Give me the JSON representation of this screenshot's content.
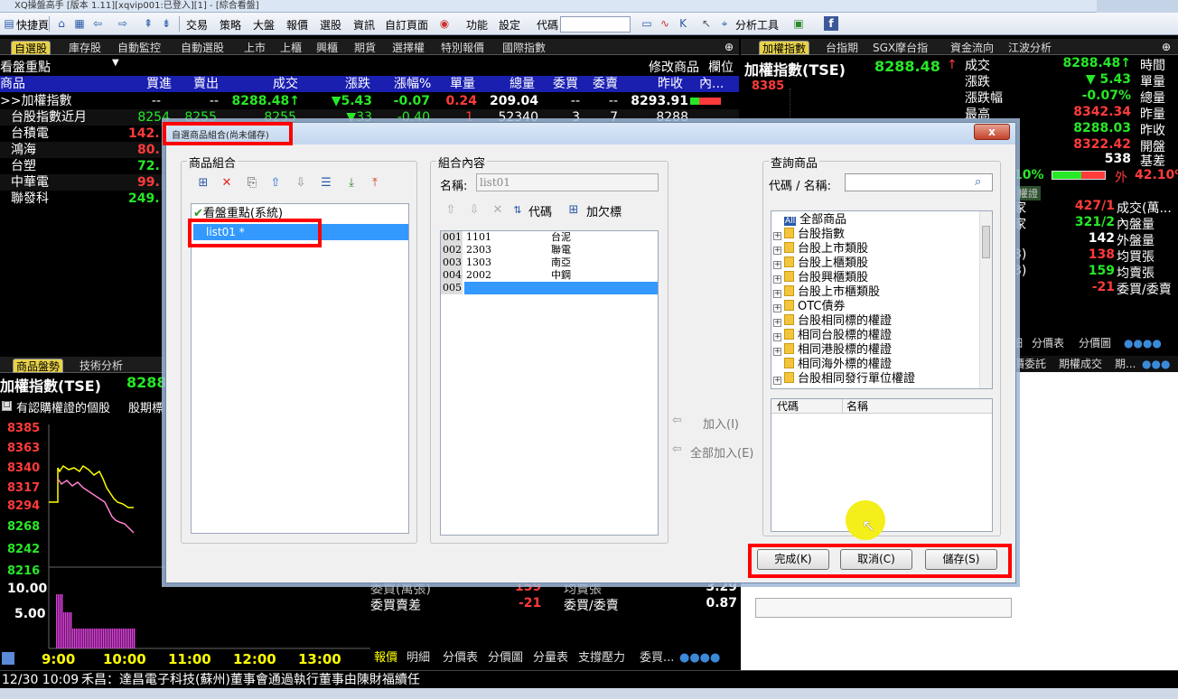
{
  "window": {
    "title": "XQ操盤高手 [版本 1.11][xqvip001:已登入][1] - [綜合看盤]"
  },
  "toolbar": {
    "quick_table": "快捷頁",
    "menus": [
      "交易",
      "策略",
      "大盤",
      "報價",
      "選股",
      "資訊",
      "自訂頁面",
      "功能",
      "設定"
    ],
    "code_label": "代碼",
    "analysis_tools": "分析工具"
  },
  "left_tabs": [
    "自選股",
    "庫存股",
    "自動監控",
    "自動選股",
    "上市",
    "上櫃",
    "興櫃",
    "期貨",
    "選擇權",
    "特別報價",
    "國際指數"
  ],
  "group_selector": "看盤重點",
  "edit_products": "修改商品",
  "edit_columns": "欄位",
  "quote_headers": [
    "商品",
    "買進",
    "賣出",
    "成交",
    "漲跌",
    "漲幅%",
    "單量",
    "總量",
    "委買",
    "委賣",
    "昨收",
    "內..."
  ],
  "quote_rows": [
    {
      "name": ">>加權指數",
      "bid": "--",
      "ask": "--",
      "last": "8288.48↑",
      "chg": "▼5.43",
      "pct": "-0.07",
      "vol": "0.24",
      "total": "209.04",
      "b": "--",
      "s": "--",
      "prev": "8293.91"
    },
    {
      "name": "台股指數近月",
      "bid": "8254",
      "ask": "8255",
      "last": "8255",
      "chg": "▼33",
      "pct": "-0.40",
      "vol": "1",
      "total": "52340",
      "b": "3",
      "s": "7",
      "prev": "8288"
    },
    {
      "name": "台積電",
      "bid": "142.",
      "ask": "",
      "last": "",
      "chg": "",
      "pct": "",
      "vol": "",
      "total": "",
      "b": "",
      "s": "",
      "prev": ""
    },
    {
      "name": "鴻海",
      "bid": "80.",
      "ask": "",
      "last": "",
      "chg": "",
      "pct": "",
      "vol": "",
      "total": "",
      "b": "",
      "s": "",
      "prev": ""
    },
    {
      "name": "台塑",
      "bid": "72.",
      "ask": "",
      "last": "",
      "chg": "",
      "pct": "",
      "vol": "",
      "total": "",
      "b": "",
      "s": "",
      "prev": ""
    },
    {
      "name": "中華電",
      "bid": "99.",
      "ask": "",
      "last": "",
      "chg": "",
      "pct": "",
      "vol": "",
      "total": "",
      "b": "",
      "s": "",
      "prev": ""
    },
    {
      "name": "聯發科",
      "bid": "249.",
      "ask": "",
      "last": "",
      "chg": "",
      "pct": "",
      "vol": "",
      "total": "",
      "b": "",
      "s": "",
      "prev": ""
    }
  ],
  "right_tabs": [
    "加權指數",
    "台指期",
    "SGX摩台指",
    "資金流向",
    "江波分析"
  ],
  "right_title": "加權指數(TSE)",
  "right_price": "8288.48",
  "right_stats": [
    {
      "label": "成交",
      "value": "8288.48↑",
      "label2": "時間"
    },
    {
      "label": "漲跌",
      "value": "▼ 5.43",
      "label2": "單量"
    },
    {
      "label": "漲跌幅",
      "value": "-0.07%",
      "label2": "總量"
    },
    {
      "label": "最高",
      "value": "8342.34",
      "label2": "昨量"
    },
    {
      "label": "",
      "value": "8288.03",
      "label2": "昨收"
    },
    {
      "label": "",
      "value": "8322.42",
      "label2": "開盤"
    },
    {
      "label": "",
      "value": "538",
      "label2": "基差"
    }
  ],
  "right_chart_top": "8385",
  "right_pct": {
    "a": "10%",
    "b": "外",
    "c": "42.10%"
  },
  "right_warrant": "權證",
  "right_lower": [
    {
      "pre": "家",
      "value": "427/1",
      "label": "成交(萬..."
    },
    {
      "pre": "家",
      "value": "321/2",
      "label": "內盤量"
    },
    {
      "pre": "",
      "value": "142",
      "label": "外盤量"
    },
    {
      "pre": "3)",
      "value": "138",
      "label": "均買張"
    },
    {
      "pre": "3)",
      "value": "159",
      "label": "均賣張"
    },
    {
      "pre": "",
      "value": "-21",
      "label": "委買/委賣"
    }
  ],
  "right_bottom_tabs": [
    "細",
    "分價表",
    "分價圖"
  ],
  "right_bottom_tabs2": [
    "價委託",
    "期權成交",
    "期..."
  ],
  "chart_tabs": [
    "商品盤勢",
    "技術分析"
  ],
  "chart_title": "加權指數(TSE)",
  "chart_price": "8288",
  "chart_checkbox": "有認購權證的個股",
  "chart_period": "股期標",
  "chart_yticks": [
    "8385",
    "8363",
    "8340",
    "8317",
    "8294",
    "8268",
    "8242",
    "8216"
  ],
  "chart_vol_ticks": [
    "10.00",
    "5.00"
  ],
  "chart_xticks": [
    "9:00",
    "10:00",
    "11:00",
    "12:00",
    "13:00"
  ],
  "chart_bottom_tabs": [
    "報價",
    "明細",
    "分價表",
    "分價圖",
    "分量表",
    "支撐壓力",
    "委買..."
  ],
  "mid_stats": [
    {
      "label": "委買(萬張)",
      "value": "159",
      "label2": "均賣張",
      "value2": "3.29"
    },
    {
      "label": "委買賣差",
      "value": "-21",
      "label2": "委買/委賣",
      "value2": "0.87"
    }
  ],
  "news": {
    "time": "12/30 10:09",
    "text": "禾昌：達昌電子科技(蘇州)董事會通過執行董事由陳財福續任"
  },
  "dialog": {
    "title": "自選商品組合(尚未儲存)",
    "close": "x",
    "group_box": "商品組合",
    "groups": [
      {
        "label": "看盤重點(系統)",
        "check": "✔"
      },
      {
        "label": "list01 *"
      }
    ],
    "content_box": "組合內容",
    "name_label": "名稱:",
    "name_value": "list01",
    "code_btn": "代碼",
    "add_target_btn": "加欠標",
    "items": [
      {
        "no": "001",
        "code": "1101",
        "name": "台泥"
      },
      {
        "no": "002",
        "code": "2303",
        "name": "聯電"
      },
      {
        "no": "003",
        "code": "1303",
        "name": "南亞"
      },
      {
        "no": "004",
        "code": "2002",
        "name": "中鋼"
      },
      {
        "no": "005",
        "code": "",
        "name": ""
      }
    ],
    "add_btn": "加入(I)",
    "add_all_btn": "全部加入(E)",
    "query_box": "查詢商品",
    "query_label": "代碼 / 名稱:",
    "query_value": "",
    "tree": [
      {
        "label": "全部商品",
        "all": true
      },
      {
        "label": "台股指數"
      },
      {
        "label": "台股上市類股"
      },
      {
        "label": "台股上櫃類股"
      },
      {
        "label": "台股興櫃類股"
      },
      {
        "label": "台股上市櫃類股"
      },
      {
        "label": "OTC債券"
      },
      {
        "label": "台股相同標的權證"
      },
      {
        "label": "相同台股標的權證"
      },
      {
        "label": "相同港股標的權證"
      },
      {
        "label": "相同海外標的權證"
      },
      {
        "label": "台股相同發行單位權證"
      }
    ],
    "tree_all_badge": "All",
    "result_headers": [
      "代碼",
      "名稱"
    ],
    "buttons": {
      "done": "完成(K)",
      "cancel": "取消(C)",
      "save": "儲存(S)"
    }
  },
  "colors": {
    "accent_red": "#ff0000",
    "up": "#ff3b3b",
    "down": "#27e827",
    "selection": "#3399ff",
    "tab_active": "#e8d24a"
  }
}
